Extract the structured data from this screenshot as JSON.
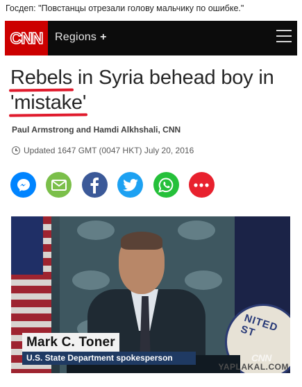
{
  "caption": "Госдеп: \"Повстанцы отрезали голову мальчику по ошибке.\"",
  "header": {
    "logo_text": "CNN",
    "regions_label": "Regions",
    "regions_plus": "+",
    "menu_icon": "hamburger-icon"
  },
  "article": {
    "headline_part1": "Rebels",
    "headline_part2": " in Syria behead boy in ",
    "headline_part3": "'mistake'",
    "byline": "Paul Armstrong and Hamdi Alkhshali, CNN",
    "updated": "Updated 1647 GMT (0047 HKT) July 20, 2016"
  },
  "share_buttons": [
    {
      "name": "messenger",
      "icon": "messenger-icon",
      "color": "#0084ff"
    },
    {
      "name": "email",
      "icon": "email-icon",
      "color": "#7bbf4a"
    },
    {
      "name": "facebook",
      "icon": "facebook-icon",
      "color": "#3b5998"
    },
    {
      "name": "twitter",
      "icon": "twitter-icon",
      "color": "#1da1f2"
    },
    {
      "name": "whatsapp",
      "icon": "whatsapp-icon",
      "color": "#25c03a"
    },
    {
      "name": "more",
      "icon": "more-icon",
      "color": "#e8212e"
    }
  ],
  "video": {
    "lower_third_name": "Mark C. Toner",
    "lower_third_title": "U.S. State Department spokesperson",
    "channel_bug": "CNN",
    "seal_text": "NITED ST",
    "watermark": "YAPLAKAL.COM"
  },
  "colors": {
    "cnn_red": "#cc0000",
    "topbar": "#0c0c0c",
    "headline_underline": "#e01b2d"
  }
}
